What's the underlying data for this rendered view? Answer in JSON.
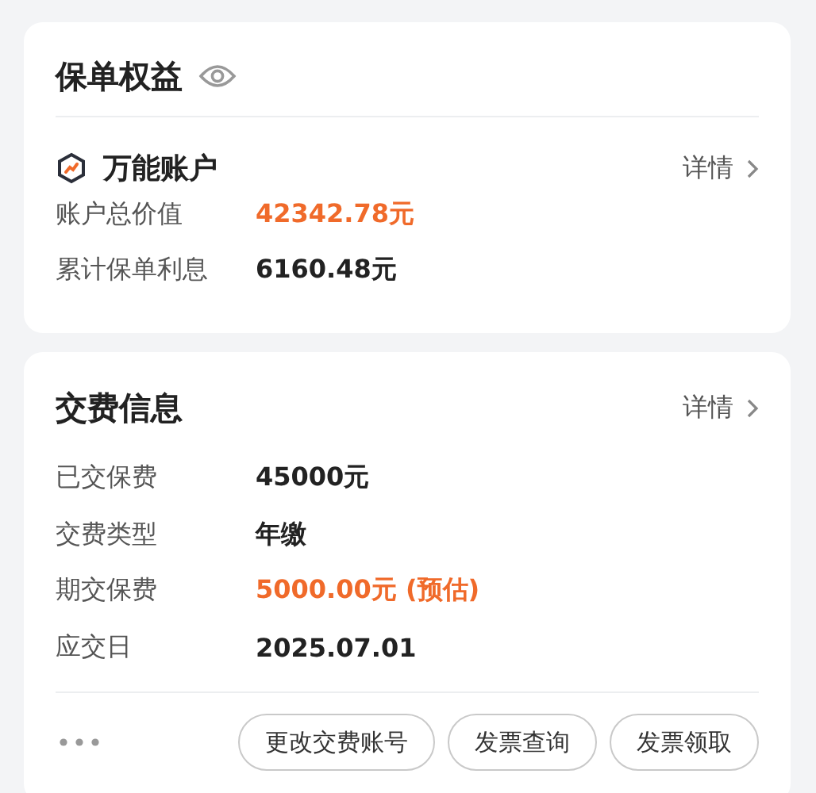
{
  "policy_card": {
    "title": "保单权益",
    "account": {
      "name": "万能账户",
      "link": "详情"
    },
    "rows": [
      {
        "label": "账户总价值",
        "value": "42342.78元",
        "highlight": true
      },
      {
        "label": "累计保单利息",
        "value": "6160.48元",
        "highlight": false
      }
    ]
  },
  "payment_card": {
    "title": "交费信息",
    "link": "详情",
    "rows": [
      {
        "label": "已交保费",
        "value": "45000元",
        "highlight": false
      },
      {
        "label": "交费类型",
        "value": "年缴",
        "highlight": false
      },
      {
        "label": "期交保费",
        "value": "5000.00元 (预估)",
        "highlight": true
      },
      {
        "label": "应交日",
        "value": "2025.07.01",
        "highlight": false
      }
    ],
    "buttons": [
      "更改交费账号",
      "发票查询",
      "发票领取"
    ]
  }
}
